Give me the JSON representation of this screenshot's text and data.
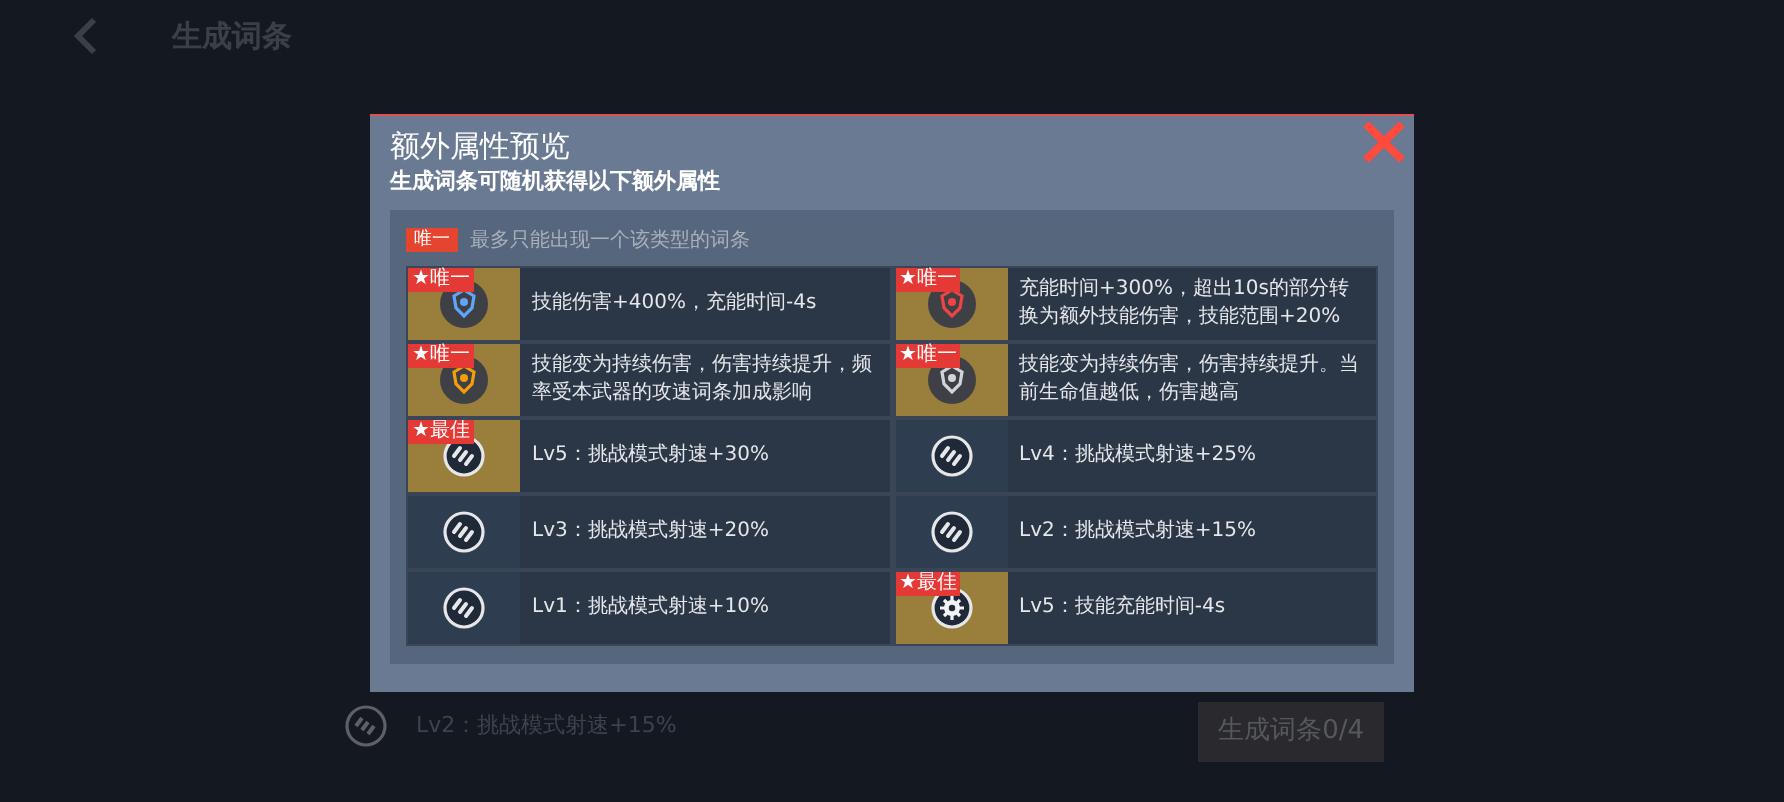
{
  "page": {
    "title": "生成词条",
    "behind_row": "Lv2：挑战模式射速+15%",
    "generate_button": "生成词条0/4"
  },
  "dialog": {
    "title": "额外属性预览",
    "subtitle": "生成词条可随机获得以下额外属性",
    "legend": {
      "tag": "唯一",
      "text": "最多只能出现一个该类型的词条"
    },
    "items": [
      {
        "kind": "featured",
        "badge": "★唯一",
        "text": "技能伤害+400%，充能时间-4s"
      },
      {
        "kind": "featured",
        "badge": "★唯一",
        "text": "充能时间+300%，超出10s的部分转换为额外技能伤害，技能范围+20%"
      },
      {
        "kind": "featured",
        "badge": "★唯一",
        "text": "技能变为持续伤害，伤害持续提升，频率受本武器的攻速词条加成影响"
      },
      {
        "kind": "featured",
        "badge": "★唯一",
        "text": "技能变为持续伤害，伤害持续提升。当前生命值越低，伤害越高"
      },
      {
        "kind": "featured",
        "badge": "★最佳",
        "text": "Lv5：挑战模式射速+30%"
      },
      {
        "kind": "plain",
        "text": "Lv4：挑战模式射速+25%"
      },
      {
        "kind": "plain",
        "text": "Lv3：挑战模式射速+20%"
      },
      {
        "kind": "plain",
        "text": "Lv2：挑战模式射速+15%"
      },
      {
        "kind": "plain",
        "text": "Lv1：挑战模式射速+10%"
      },
      {
        "kind": "featured",
        "badge": "★最佳",
        "text": "Lv5：技能充能时间-4s"
      }
    ]
  }
}
